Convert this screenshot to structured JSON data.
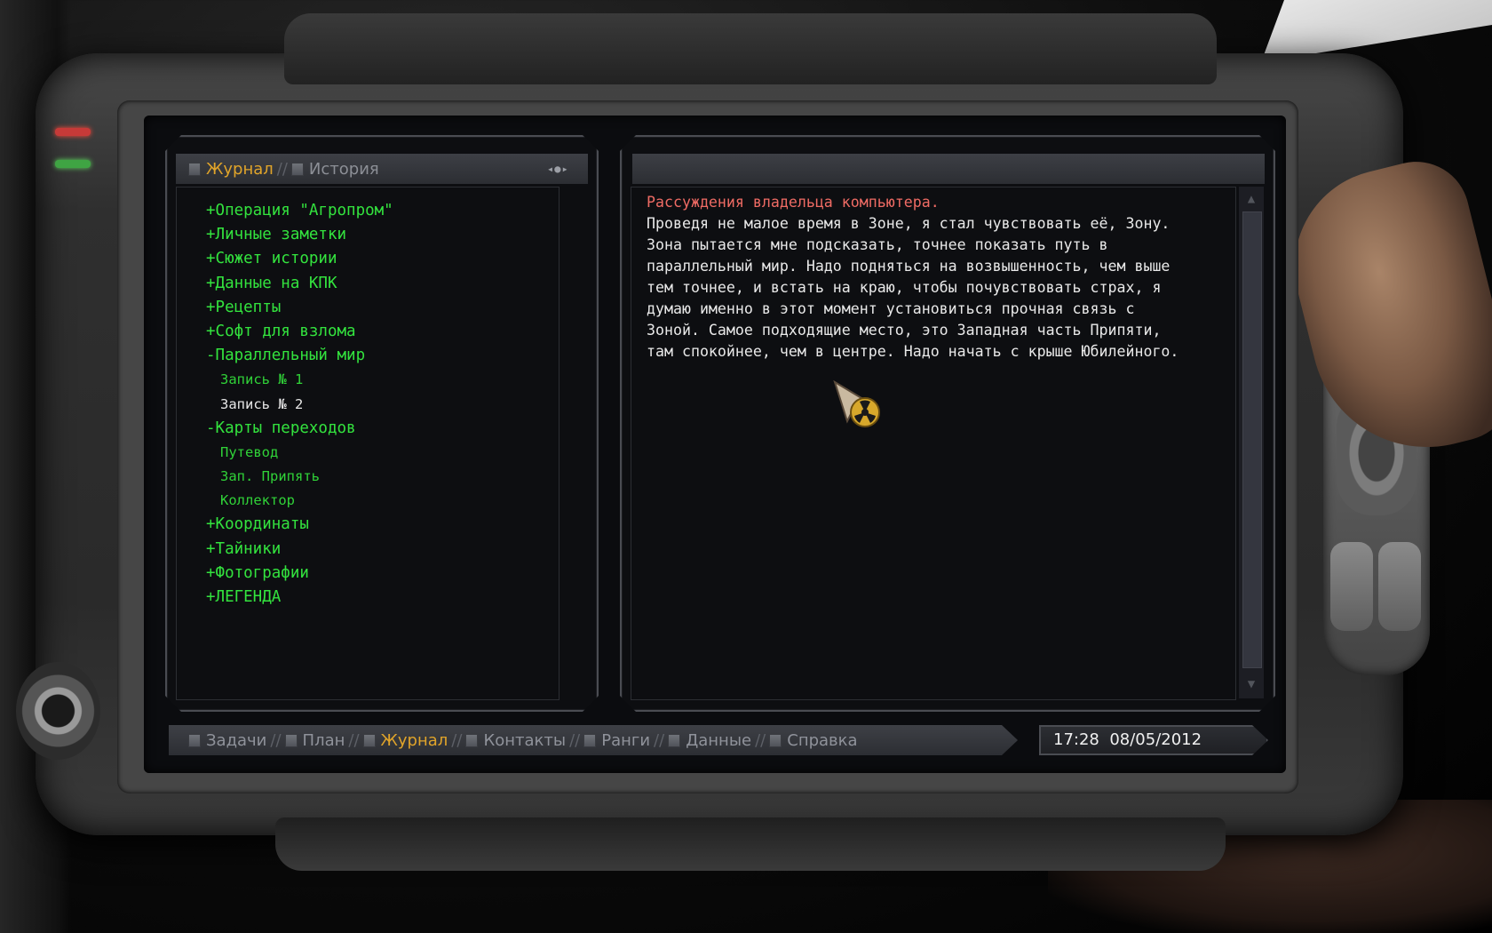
{
  "left_tabs": [
    {
      "label": "Журнал",
      "active": true
    },
    {
      "label": "История",
      "active": false
    }
  ],
  "tree": [
    {
      "label": "+Операция \"Агропром\"",
      "level": 0
    },
    {
      "label": "+Личные заметки",
      "level": 0
    },
    {
      "label": "+Сюжет истории",
      "level": 0
    },
    {
      "label": "+Данные на КПК",
      "level": 0
    },
    {
      "label": "+Рецепты",
      "level": 0
    },
    {
      "label": "+Софт для взлома",
      "level": 0
    },
    {
      "label": "-Параллельный мир",
      "level": 0
    },
    {
      "label": "Запись № 1",
      "level": 1
    },
    {
      "label": "Запись № 2",
      "level": 1,
      "selected": true
    },
    {
      "label": "-Карты переходов",
      "level": 0
    },
    {
      "label": "Путевод",
      "level": 1
    },
    {
      "label": "Зап. Припять",
      "level": 1
    },
    {
      "label": "Коллектор",
      "level": 1
    },
    {
      "label": "+Координаты",
      "level": 0
    },
    {
      "label": "+Тайники",
      "level": 0
    },
    {
      "label": "+Фотографии",
      "level": 0
    },
    {
      "label": "+ЛЕГЕНДА",
      "level": 0
    }
  ],
  "entry": {
    "title": "Рассуждения владельца компьютера.",
    "lines": [
      "Проведя не малое время в Зоне, я стал чувствовать её, Зону.",
      "Зона пытается мне подсказать, точнее показать путь в",
      "параллельный мир. Надо подняться на возвышенность, чем выше",
      "тем точнее, и встать на краю, чтобы почувствовать страх, я",
      "думаю именно в этот момент установиться прочная связь с",
      "Зоной. Самое подходящие место, это Западная часть Припяти,",
      "там спокойнее, чем в центре. Надо начать с крыше Юбилейного."
    ]
  },
  "bottom_tabs": [
    {
      "label": "Задачи",
      "active": false
    },
    {
      "label": "План",
      "active": false
    },
    {
      "label": "Журнал",
      "active": true
    },
    {
      "label": "Контакты",
      "active": false
    },
    {
      "label": "Ранги",
      "active": false
    },
    {
      "label": "Данные",
      "active": false
    },
    {
      "label": "Справка",
      "active": false
    }
  ],
  "tab_separator": "//",
  "clock": "17:28  08/05/2012",
  "colors": {
    "accent": "#e0a42a",
    "tree_green": "#33e33e",
    "entry_title": "#ef6b64",
    "text": "#e9e9e9"
  }
}
